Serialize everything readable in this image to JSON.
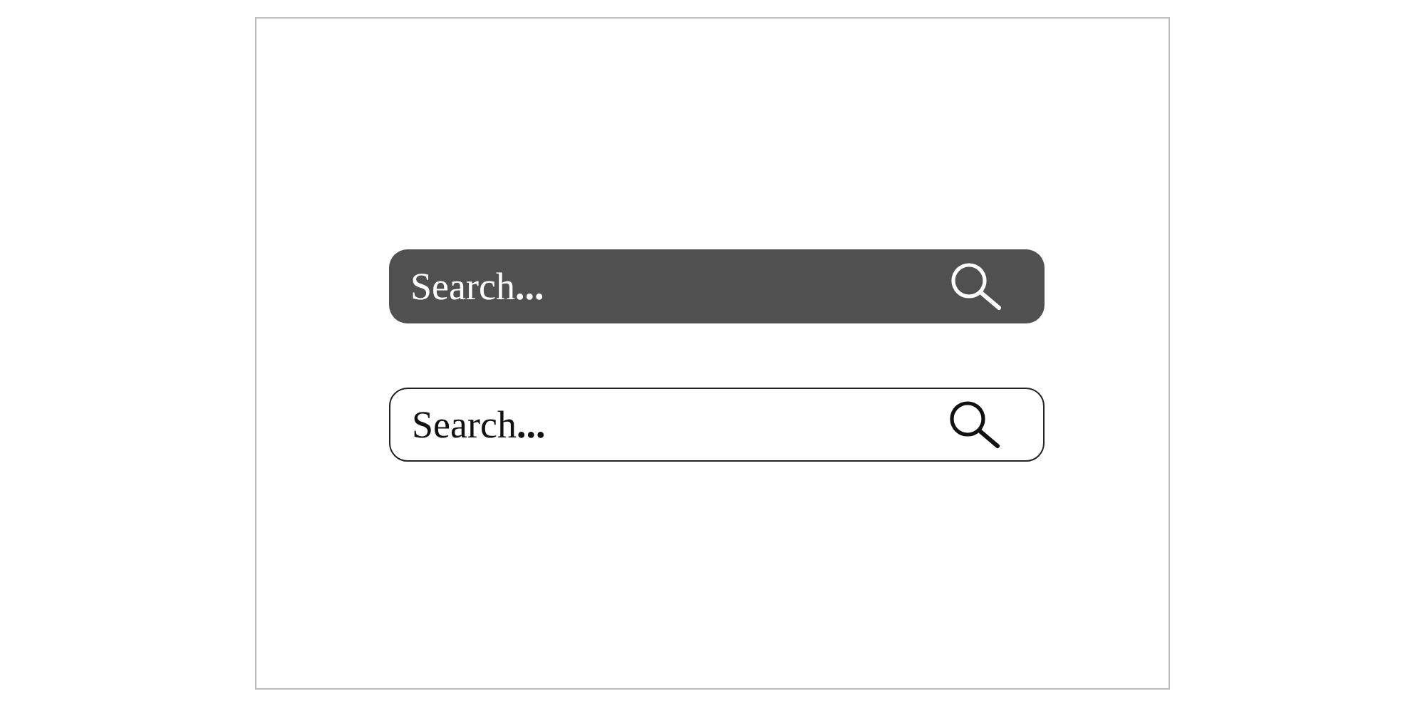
{
  "search_bars": [
    {
      "kind": "filled",
      "placeholder": "Search**...**"
    },
    {
      "kind": "outlined",
      "placeholder": "Search**...**"
    }
  ]
}
